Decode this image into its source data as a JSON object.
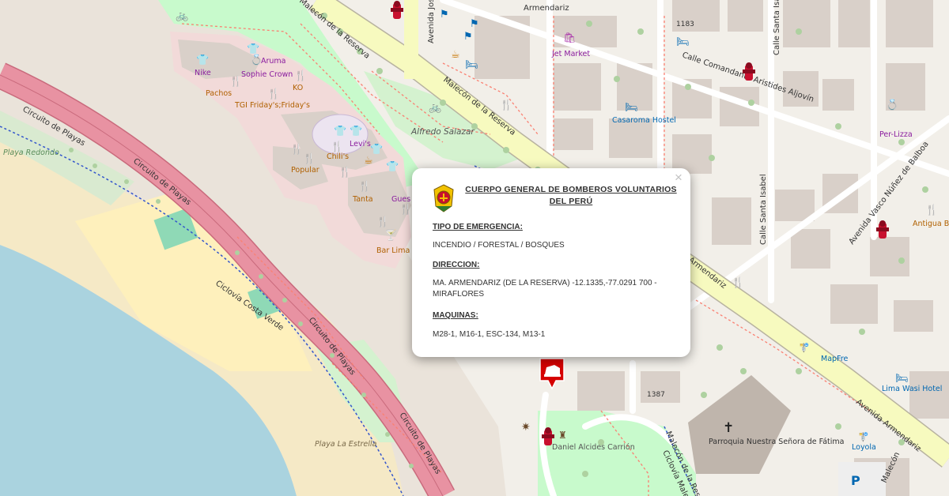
{
  "map": {
    "streets": {
      "armendariz_top": "Armendariz",
      "malecon_reserva_top": "Malecón de la Reserva",
      "malecon_reserva_mid": "Malecón de la Reserva",
      "avenida_jose": "Avenida José",
      "calle_comandante": "Calle Comandante Aristides Aljovín",
      "calle_santa_isabel_1": "Calle Santa Isabel",
      "calle_santa_isabel_2": "Calle Santa Isabel",
      "avenida_vasco": "Avenida Vasco Núñez de Balboa",
      "avenida_armendariz": "Avenida Armendariz",
      "armendariz_mid": "Armendariz",
      "circuito_1": "Circuito de Playas",
      "circuito_2": "Circuito de Playas",
      "circuito_3": "Circuito de Playas",
      "circuito_4": "Circuito de Playas",
      "ciclovia_costa": "Ciclovía Costa Verde",
      "malecon_bottom": "Malecón de la Reserva",
      "ciclovia_bottom": "Ciclovía Malecón",
      "malecon_right_bottom": "Malecón"
    },
    "places": {
      "nike": "Nike",
      "aruma": "Aruma",
      "sophie_crown": "Sophie Crown",
      "pachos": "Pachos",
      "ko": "KO",
      "tgi": "TGI Friday's;Friday's",
      "levis": "Levi's",
      "chilis": "Chili's",
      "popular": "Popular",
      "alfredo_salazar": "Alfredo Salazar",
      "tanta": "Tanta",
      "gues": "Gues",
      "bar_lima": "Bar Lima",
      "jet_market": "Jet Market",
      "casaroma": "Casaroma Hostel",
      "per_lizza": "Per-Lizza",
      "antigua_bodega": "Antigua Bodega Dalmacia",
      "mapfre": "MapFre",
      "lima_wasi": "Lima Wasi Hotel",
      "parroquia": "Parroquia Nuestra Señora de Fátima",
      "daniel_alcides": "Daniel Alcides Carrión",
      "loyola": "Loyola",
      "playa_redondo": "Playa Redondo",
      "playa_la_estrella": "Playa La Estrella",
      "num_1183": "1183",
      "num_1387": "1387",
      "parking": "P"
    }
  },
  "popup": {
    "title": "CUERPO GENERAL DE BOMBEROS VOLUNTARIOS DEL PERÚ",
    "emergency_label": "TIPO DE EMERGENCIA:",
    "emergency_value": "INCENDIO / FORESTAL / BOSQUES",
    "address_label": "DIRECCION:",
    "address_value": "MA. ARMENDARIZ (DE LA RESERVA) -12.1335,-77.0291 700 - MIRAFLORES",
    "machines_label": "MAQUINAS:",
    "machines_value": "M28-1, M16-1, ESC-134, M13-1",
    "close_glyph": "×"
  },
  "colors": {
    "sea": "#aad3df",
    "beach": "#fff1ba",
    "park": "#c8facc",
    "commercial": "#f2dad9",
    "primary_road": "#fcd6a4",
    "trunk_road": "#e892a2",
    "secondary_road": "#f7fabf",
    "hydrant": "#c8102e",
    "marker": "#d50000"
  },
  "icons": [
    "fire-hydrant-icon",
    "fire-truck-marker-icon",
    "church-icon",
    "restaurant-icon",
    "clothes-shop-icon",
    "cafe-icon",
    "hotel-icon",
    "bus-stop-icon",
    "bicycle-rental-icon",
    "parking-icon",
    "firefighter-badge-icon"
  ]
}
